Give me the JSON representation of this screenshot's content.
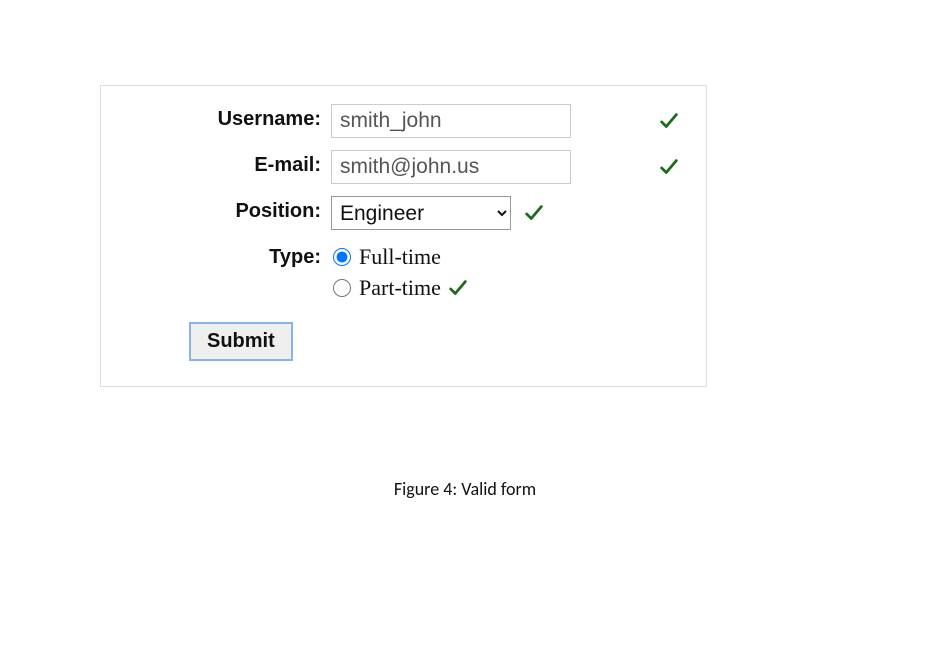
{
  "form": {
    "username": {
      "label": "Username:",
      "value": "smith_john"
    },
    "email": {
      "label": "E-mail:",
      "value": "smith@john.us"
    },
    "position": {
      "label": "Position:",
      "selected": "Engineer"
    },
    "type": {
      "label": "Type:",
      "options": [
        {
          "label": "Full-time",
          "checked": true
        },
        {
          "label": "Part-time",
          "checked": false
        }
      ]
    },
    "submit_label": "Submit"
  },
  "caption": "Figure 4: Valid form"
}
